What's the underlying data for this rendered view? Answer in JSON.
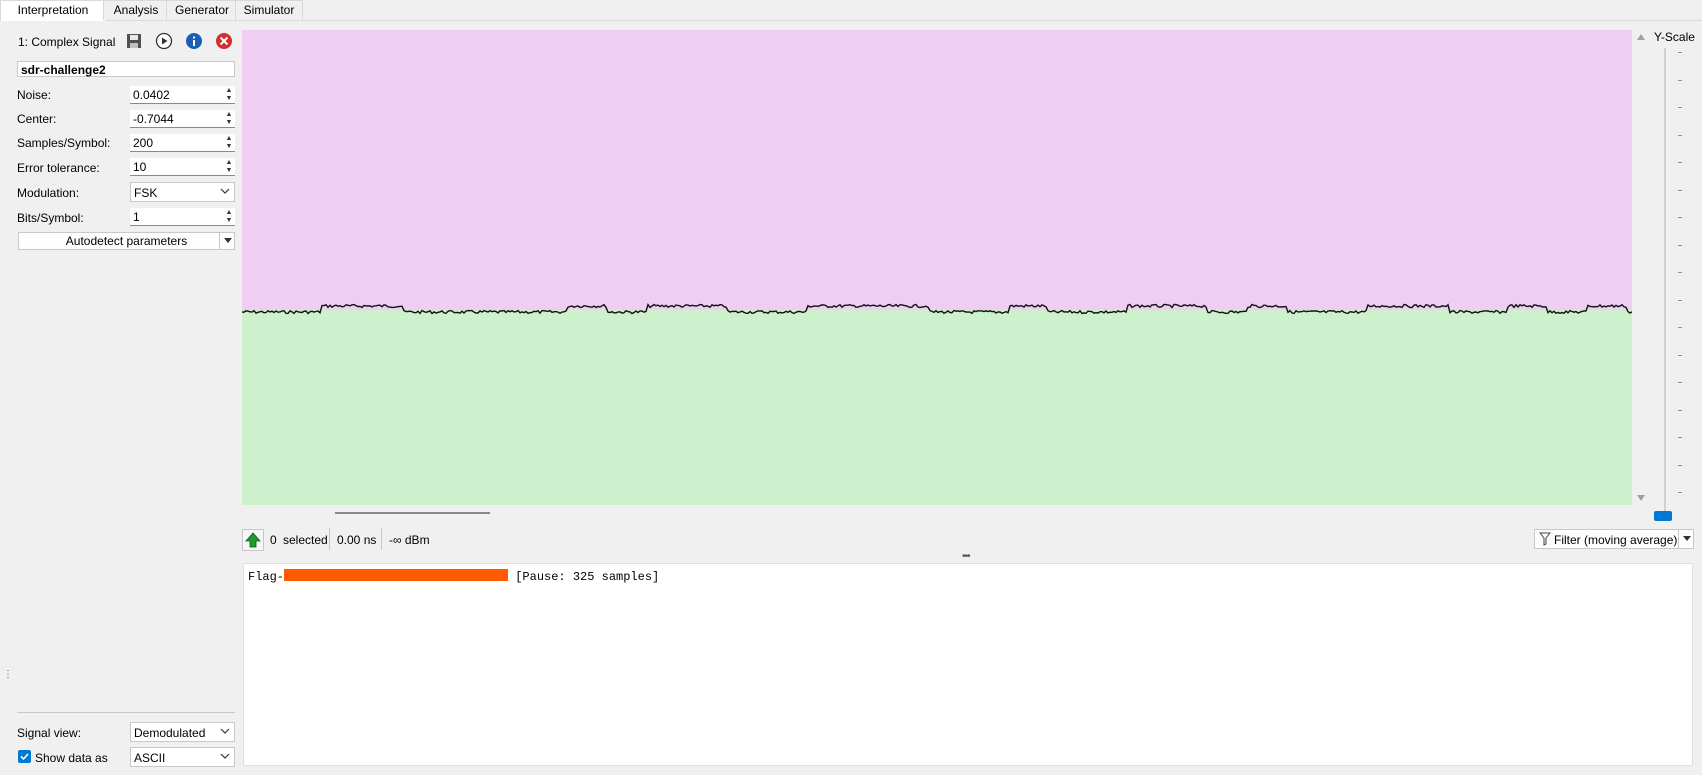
{
  "tabs": [
    {
      "label": "Interpretation",
      "active": true
    },
    {
      "label": "Analysis",
      "active": false
    },
    {
      "label": "Generator",
      "active": false
    },
    {
      "label": "Simulator",
      "active": false
    }
  ],
  "signal": {
    "index_title": "1:  Complex Signal",
    "name": "sdr-challenge2",
    "icons": [
      "save-icon",
      "play-icon",
      "info-icon",
      "close-icon"
    ]
  },
  "params": {
    "noise_label": "Noise:",
    "noise_value": "0.0402",
    "center_label": "Center:",
    "center_value": "-0.7044",
    "samples_label": "Samples/Symbol:",
    "samples_value": "200",
    "tolerance_label": "Error tolerance:",
    "tolerance_value": "10",
    "modulation_label": "Modulation:",
    "modulation_value": "FSK",
    "bits_label": "Bits/Symbol:",
    "bits_value": "1",
    "autodetect_label": "Autodetect parameters"
  },
  "view": {
    "signal_view_label": "Signal view:",
    "signal_view_value": "Demodulated",
    "show_data_label": "Show data as",
    "show_data_value": "ASCII",
    "show_data_checked": true
  },
  "graph": {
    "upper_color": "#f0cdf2",
    "lower_color": "#ccf1cc",
    "yscale_label": "Y-Scale"
  },
  "statusbar": {
    "selected_count": "0",
    "selected_label": "selected",
    "duration": "0.00 ns",
    "power": "-∞ dBm",
    "filter_label": "Filter (moving average)"
  },
  "output": {
    "prefix": "Flag-",
    "suffix": " [Pause: 325 samples]",
    "redaction_color": "#ff5a00"
  }
}
